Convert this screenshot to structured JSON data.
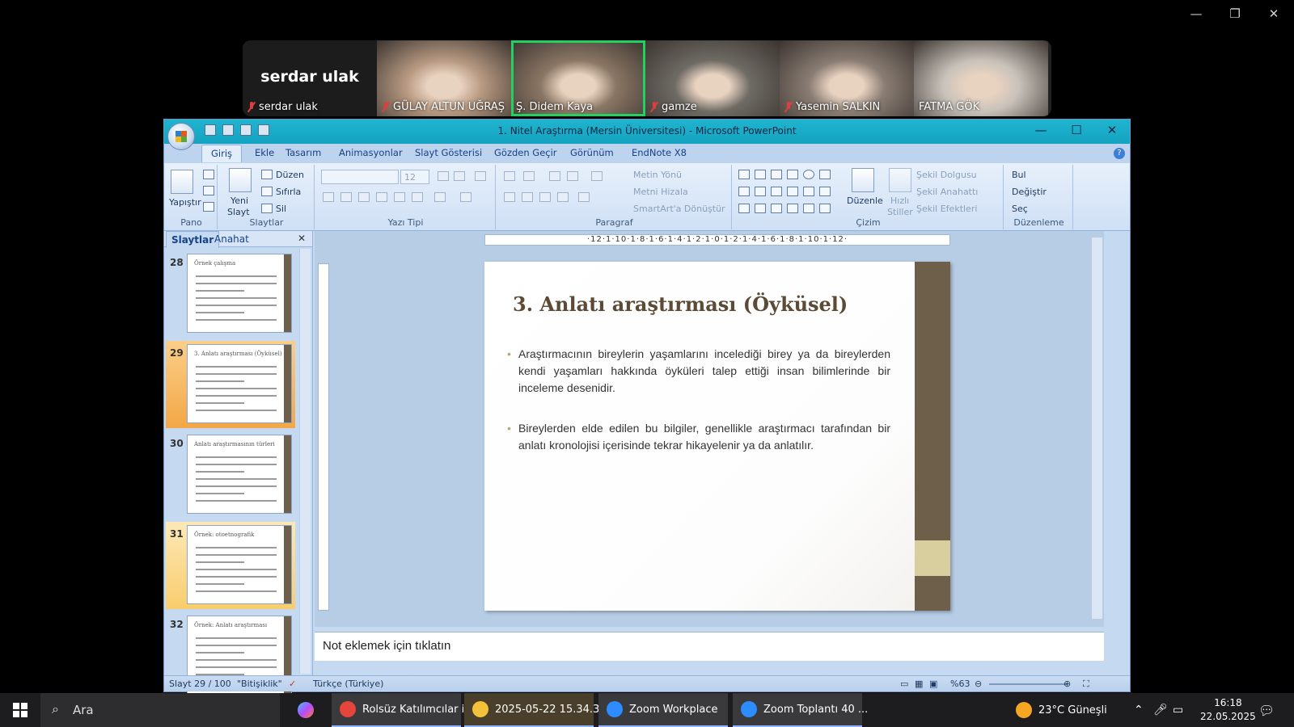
{
  "zoom": {
    "window_controls": {
      "minimize": "—",
      "restore": "❐",
      "close": "✕"
    },
    "participants": [
      {
        "name": "serdar ulak",
        "video": false,
        "muted": true,
        "bg": "#1c1c1c"
      },
      {
        "name": "GÜLAY ALTUN UĞRAŞ",
        "video": true,
        "muted": true,
        "bg": "#b89a82"
      },
      {
        "name": "Ş. Didem Kaya",
        "video": true,
        "muted": false,
        "active": true,
        "bg": "#8a7664"
      },
      {
        "name": "gamze",
        "video": true,
        "muted": true,
        "bg": "#6e6a64"
      },
      {
        "name": "Yasemin SALKIN",
        "video": true,
        "muted": true,
        "bg": "#8a7d73"
      },
      {
        "name": "FATMA GÖK",
        "video": true,
        "muted": false,
        "bg": "#c8c2ba"
      }
    ]
  },
  "ppt": {
    "window_title": "1. Nitel Araştırma (Mersin Üniversitesi) - Microsoft PowerPoint",
    "tabs": [
      "Giriş",
      "Ekle",
      "Tasarım",
      "Animasyonlar",
      "Slayt Gösterisi",
      "Gözden Geçir",
      "Görünüm",
      "EndNote X8"
    ],
    "ribbon": {
      "pano": {
        "label": "Pano",
        "paste": "Yapıştır"
      },
      "slaytlar": {
        "label": "Slaytlar",
        "new_slide_1": "Yeni",
        "new_slide_2": "Slayt",
        "layout": "Düzen",
        "reset": "Sıfırla",
        "delete": "Sil"
      },
      "yazi_tipi": {
        "label": "Yazı Tipi",
        "size": "12"
      },
      "paragraf": {
        "label": "Paragraf",
        "text_dir": "Metin Yönü",
        "align_text": "Metni Hizala",
        "smartart": "SmartArt'a Dönüştür"
      },
      "cizim": {
        "label": "Çizim",
        "arrange": "Düzenle",
        "quick_1": "Hızlı",
        "quick_2": "Stiller",
        "fill": "Şekil Dolgusu",
        "outline": "Şekil Anahattı",
        "effects": "Şekil Efektleri"
      },
      "duzenleme": {
        "label": "Düzenleme",
        "find": "Bul",
        "replace": "Değiştir",
        "select": "Seç"
      }
    },
    "pane_tabs": [
      "Slaytlar",
      "Anahat"
    ],
    "thumbnails": [
      {
        "num": "28",
        "title": "Örnek çalışma",
        "state": ""
      },
      {
        "num": "29",
        "title": "3. Anlatı araştırması (Öyküsel)",
        "state": "sel"
      },
      {
        "num": "30",
        "title": "Anlatı araştırmasının türleri",
        "state": ""
      },
      {
        "num": "31",
        "title": "Örnek: otoetnografik",
        "state": "hov"
      },
      {
        "num": "32",
        "title": "Örnek: Anlatı araştırması",
        "state": ""
      }
    ],
    "ruler_text": "·12·1·10·1·8·1·6·1·4·1·2·1·0·1·2·1·4·1·6·1·8·1·10·1·12·",
    "slide": {
      "title": "3. Anlatı araştırması (Öyküsel)",
      "bullets": [
        "Araştırmacının bireylerin yaşamlarını incelediği birey ya da bireylerden kendi yaşamları hakkında öyküleri talep ettiği insan bilimlerinde bir inceleme desenidir.",
        "Bireylerden elde edilen bu bilgiler, genellikle araştırmacı tarafından bir anlatı kronolojisi içerisinde tekrar hikayelenir ya da anlatılır."
      ]
    },
    "notes_placeholder": "Not eklemek için tıklatın",
    "status": {
      "slide": "Slayt 29 / 100",
      "theme": "\"Bitişiklik\"",
      "language": "Türkçe (Türkiye)",
      "zoom": "%63"
    }
  },
  "taskbar": {
    "search": "Ara",
    "items": [
      {
        "label": "Rolsüz Katılımcılar i...",
        "color": "#e5453b",
        "open": true
      },
      {
        "label": "2025-05-22 15.34.3...",
        "color": "#f3c13a",
        "open": true,
        "highlight": true
      },
      {
        "label": "Zoom Workplace",
        "color": "#2d8cff",
        "open": true
      },
      {
        "label": "Zoom Toplantı 40 ...",
        "color": "#2d8cff",
        "open": true
      }
    ],
    "weather": "23°C Güneşli",
    "time": "16:18",
    "date": "22.05.2025"
  }
}
